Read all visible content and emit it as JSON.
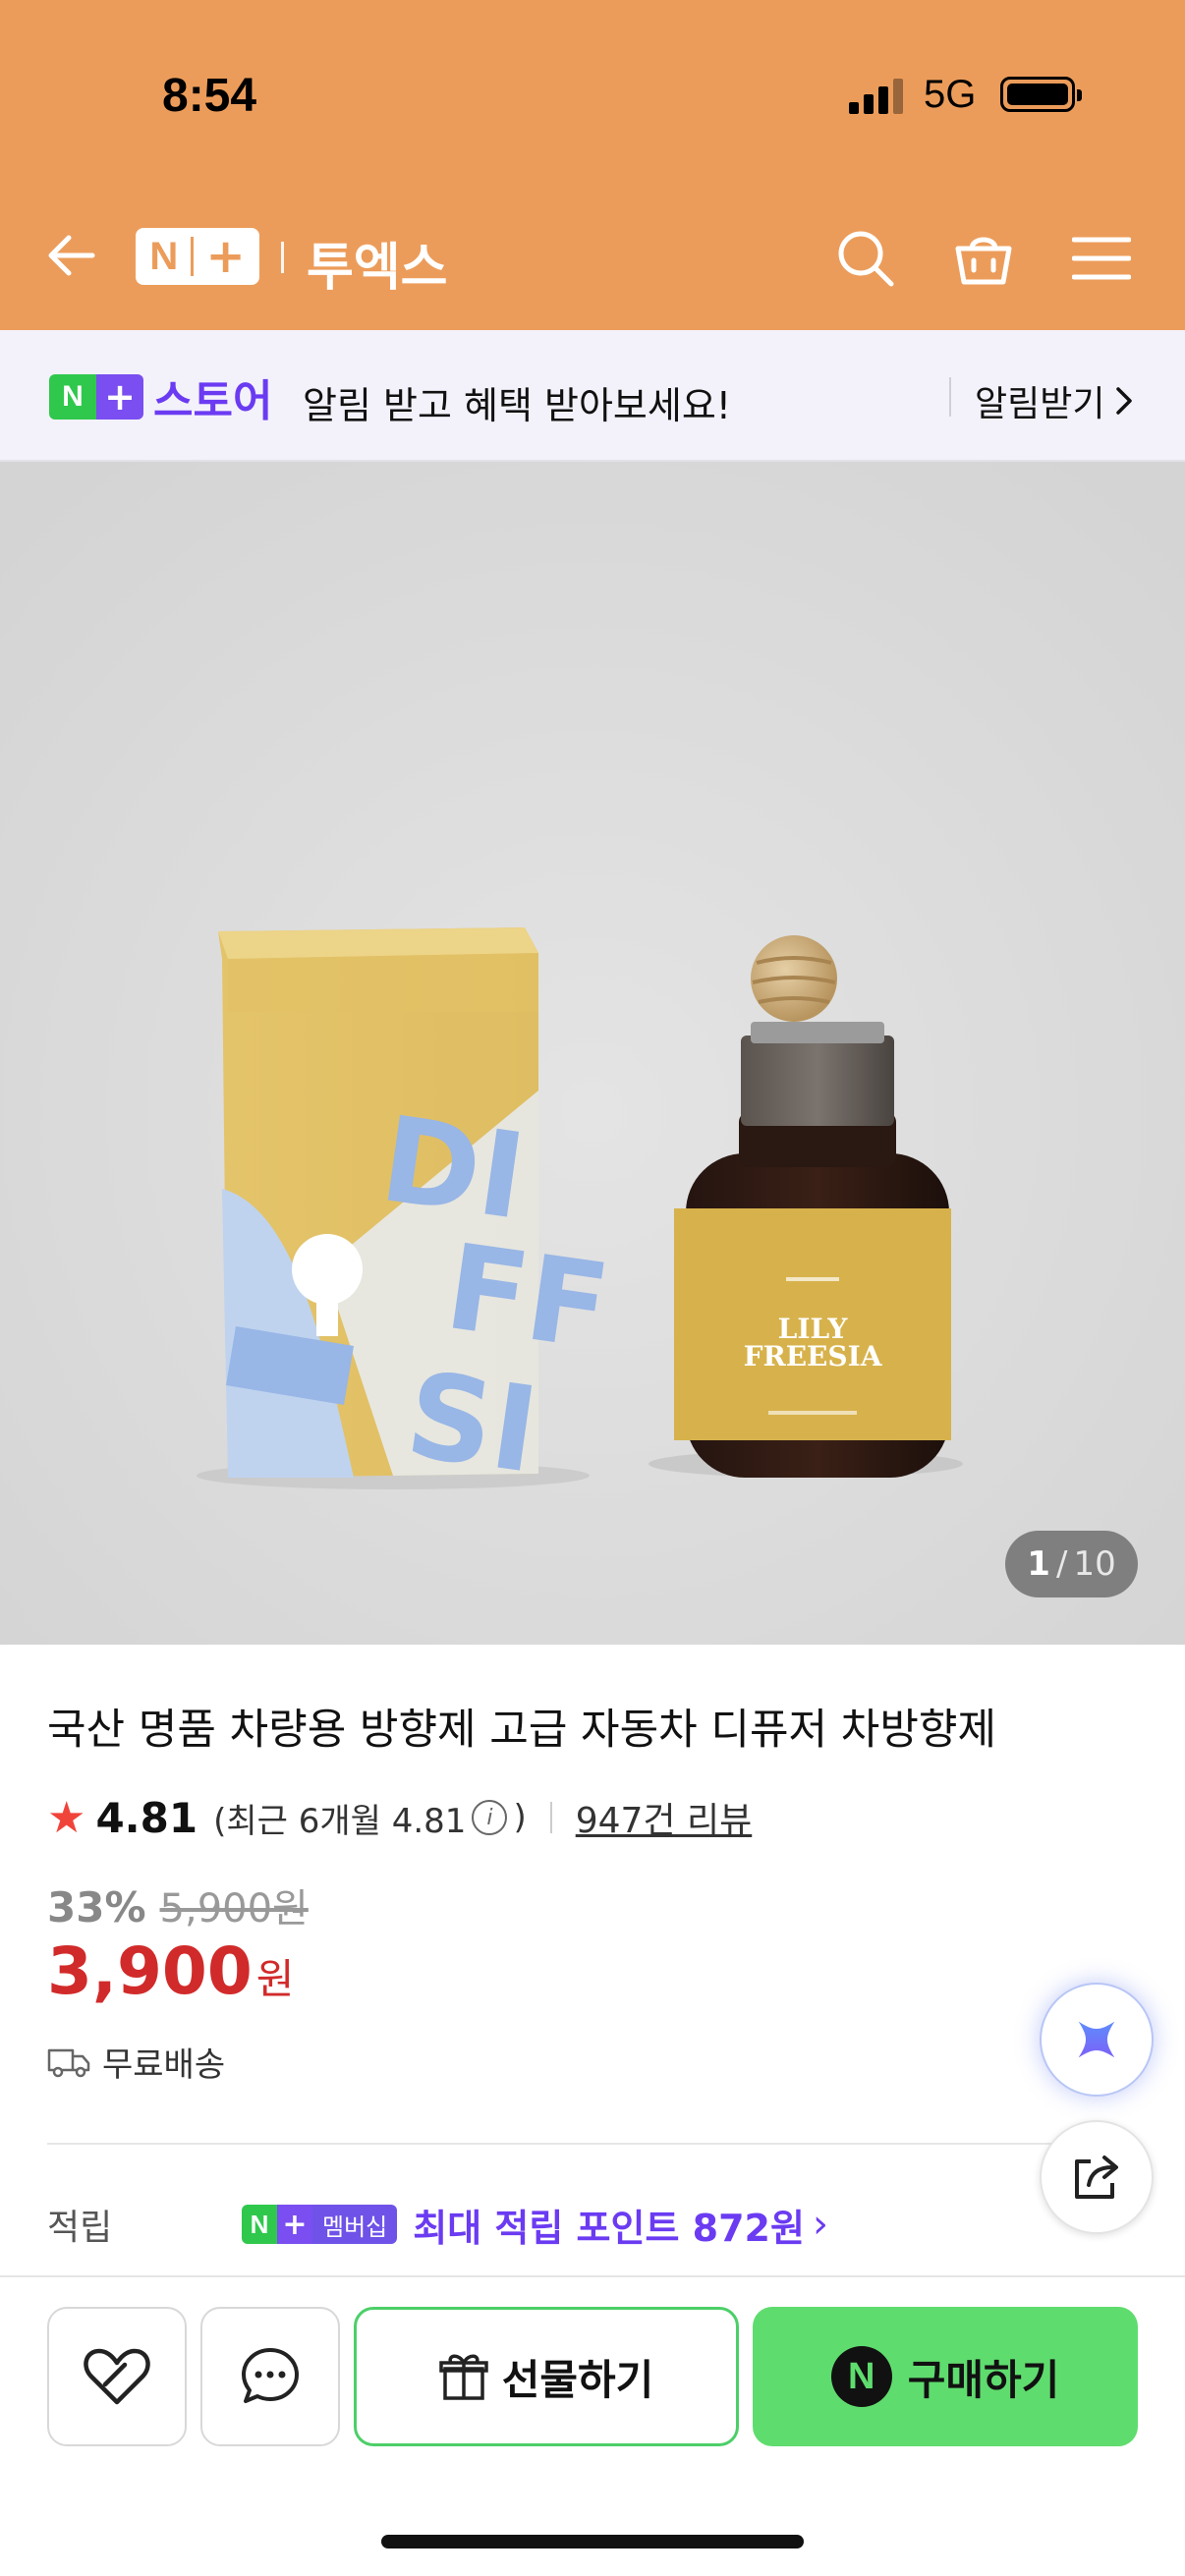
{
  "status_bar": {
    "time": "8:54",
    "network": "5G"
  },
  "nav": {
    "logo_n": "N",
    "logo_plus": "+",
    "brand": "투엑스",
    "icons": [
      "back-arrow-icon",
      "search-icon",
      "shopping-bag-icon",
      "menu-icon"
    ]
  },
  "banner": {
    "badge_n": "N",
    "badge_plus": "+",
    "store_label": "스토어",
    "message": "알림 받고 혜택 받아보세요!",
    "action": "알림받기",
    "chevron": "›"
  },
  "product_image": {
    "box_text": [
      "DI",
      "FF",
      "SI"
    ],
    "bottle_label": [
      "LILY",
      "FREESIA"
    ],
    "counter_current": "1",
    "counter_sep": "/",
    "counter_total": "10"
  },
  "product": {
    "title": "국산 명품 차량용 방향제 고급 자동차 디퓨저 차방향제",
    "rating": "4.81",
    "recent_rating": "(최근 6개월 4.81",
    "recent_close": ")",
    "info_glyph": "i",
    "reviews": "947건 리뷰",
    "discount": "33%",
    "original_price": "5,900원",
    "price": "3,900",
    "price_unit": "원",
    "shipping": "무료배송"
  },
  "points": {
    "label": "적립",
    "badge_n": "N",
    "badge_plus": "+",
    "badge_text": "멤버십",
    "max_text": "최대 적립 포인트 872원",
    "chevron": "›"
  },
  "bottom_bar": {
    "gift_label": "선물하기",
    "buy_label": "구매하기",
    "buy_badge": "N"
  },
  "colors": {
    "header_bg": "#ec9c5a",
    "naver_green": "#5fdc6e",
    "naver_purple": "#6b3bf2",
    "price_red": "#d12a2a"
  }
}
